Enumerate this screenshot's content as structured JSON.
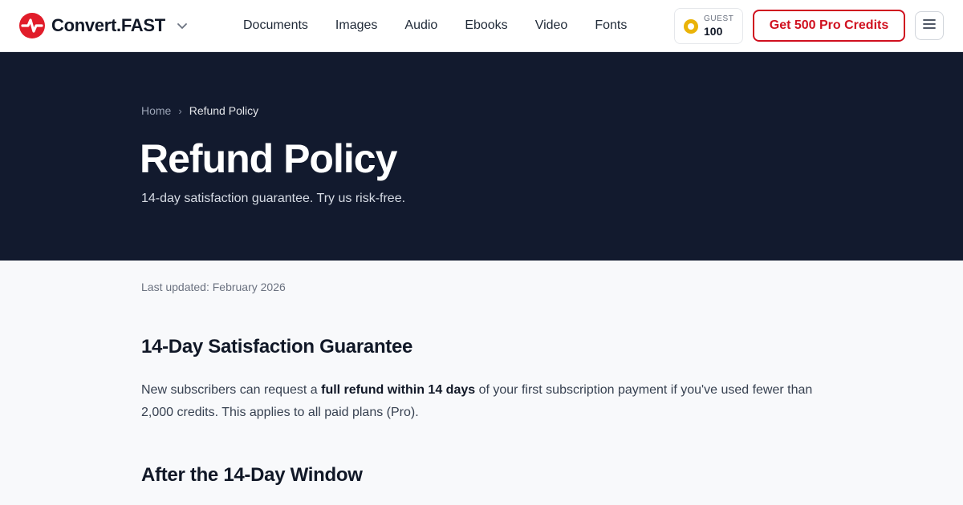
{
  "header": {
    "brand": "Convert.FAST",
    "nav": [
      "Documents",
      "Images",
      "Audio",
      "Ebooks",
      "Video",
      "Fonts"
    ],
    "guest_label": "GUEST",
    "guest_credits": "100",
    "cta_label": "Get 500 Pro Credits",
    "icons": [
      "convertfast-logo-icon",
      "chevron-down-icon",
      "coin-icon",
      "menu-icon"
    ]
  },
  "hero": {
    "breadcrumb": [
      "Home",
      "Refund Policy"
    ],
    "title": "Refund Policy",
    "subtitle": "14-day satisfaction guarantee. Try us risk-free."
  },
  "content": {
    "updated": "Last updated: February 2026",
    "sections": [
      {
        "heading": "14-Day Satisfaction Guarantee",
        "text_before": "New subscribers can request a ",
        "text_bold": "full refund within 14 days",
        "text_after": " of your first subscription payment if you've used fewer than 2,000 credits. This applies to all paid plans (Pro)."
      },
      {
        "heading": "After the 14-Day Window"
      }
    ]
  },
  "colors": {
    "brand_red": "#d0101f",
    "hero_bg": "#121a2e",
    "page_bg": "#f8f9fb",
    "coin": "#eab308"
  }
}
